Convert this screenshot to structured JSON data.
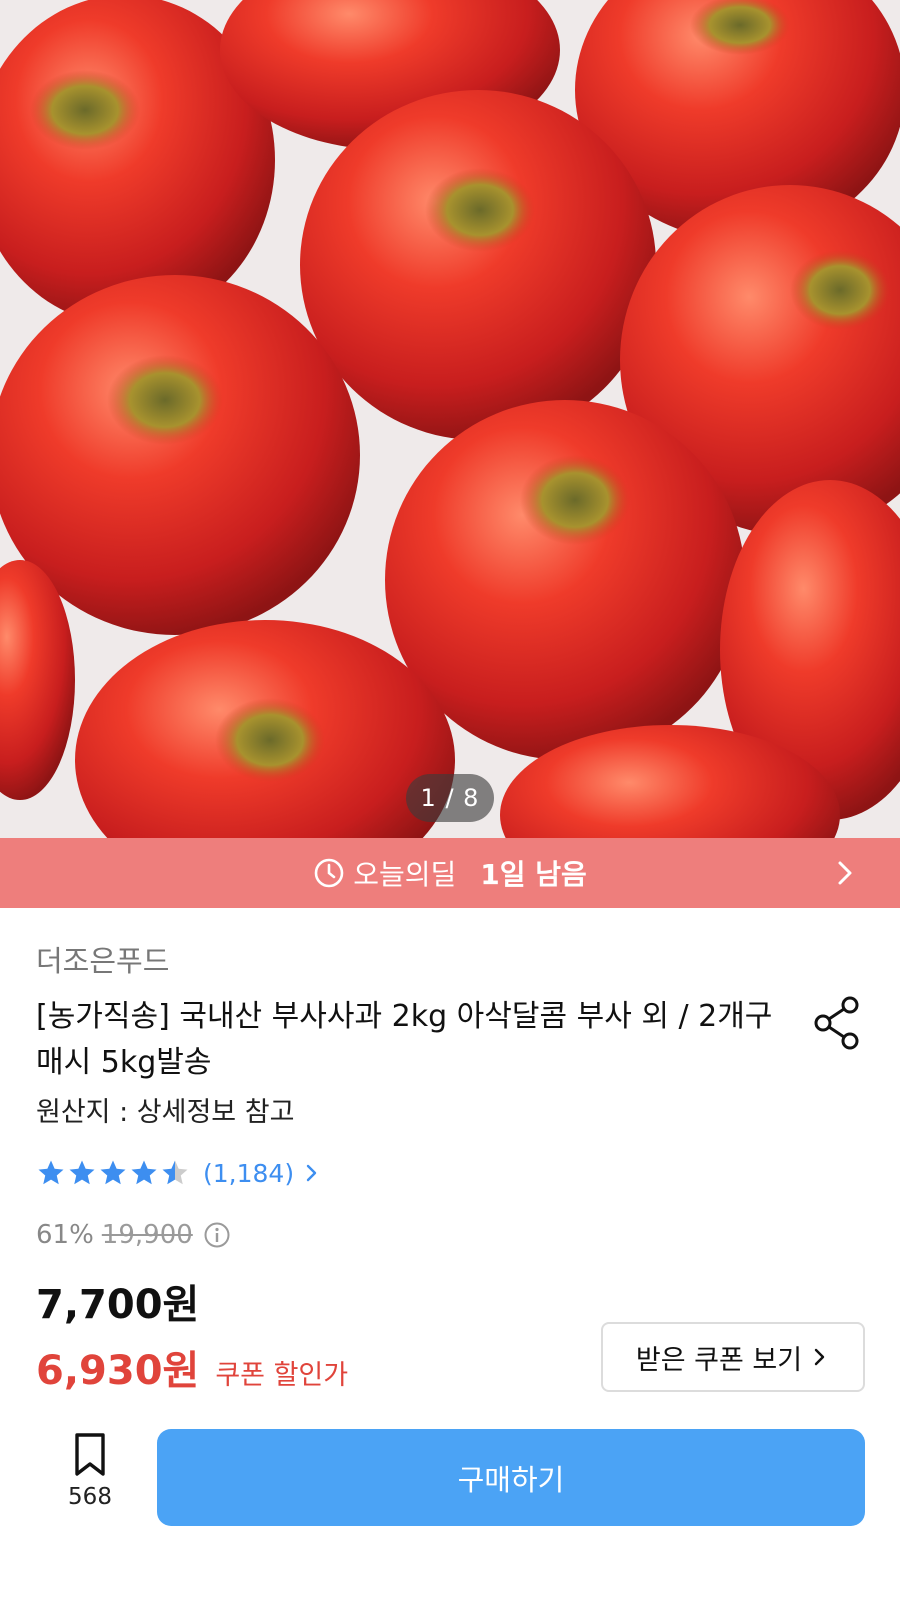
{
  "hero": {
    "pager": "1 / 8",
    "image_alt": "red apples"
  },
  "deal": {
    "label": "오늘의딜",
    "remaining": "1일 남음"
  },
  "product": {
    "seller": "더조은푸드",
    "title": "[농가직송] 국내산 부사사과 2kg 아삭달콤 부사 외 / 2개구매시 5kg발송",
    "origin": "원산지 : 상세정보 참고",
    "rating": 4.5,
    "review_count": "(1,184)",
    "discount_rate": "61%",
    "original_price": "19,900",
    "price": "7,700원",
    "coupon_price": "6,930원",
    "coupon_label": "쿠폰 할인가",
    "coupon_button": "받은 쿠폰 보기"
  },
  "bottom_bar": {
    "bookmark_count": "568",
    "buy_label": "구매하기"
  },
  "colors": {
    "deal_bar": "#ee7e7c",
    "accent_blue": "#4ba3f5",
    "price_red": "#e0443b",
    "star": "#3d8ef0"
  }
}
